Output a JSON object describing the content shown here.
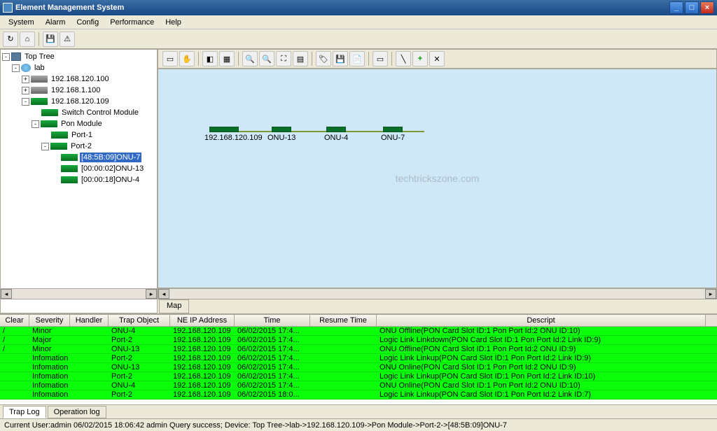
{
  "window": {
    "title": "Element Management System"
  },
  "menu": [
    "System",
    "Alarm",
    "Config",
    "Performance",
    "Help"
  ],
  "tree": {
    "root": "Top Tree",
    "lab": "lab",
    "nodes": [
      "192.168.120.100",
      "192.168.1.100",
      "192.168.120.109"
    ],
    "switch_module": "Switch Control Module",
    "pon_module": "Pon Module",
    "port1": "Port-1",
    "port2": "Port-2",
    "onu7": "[48:5B:09]ONU-7",
    "onu13": "[00:00:02]ONU-13",
    "onu4": "[00:00:18]ONU-4"
  },
  "canvas": {
    "host": "192.168.120.109",
    "devs": [
      "ONU-13",
      "ONU-4",
      "ONU-7"
    ],
    "watermark": "techtrickszone.com",
    "tab": "Map"
  },
  "log": {
    "headers": [
      "Clear",
      "Severity",
      "Handler",
      "Trap Object",
      "NE IP Address",
      "Time",
      "Resume Time",
      "Descript"
    ],
    "rows": [
      {
        "c": "/",
        "sev": "Minor",
        "obj": "ONU-4",
        "ip": "192.168.120.109",
        "t": "06/02/2015 17:4...",
        "d": "ONU Offline(PON Card Slot ID:1  Pon Port Id:2  ONU ID:10)"
      },
      {
        "c": "/",
        "sev": "Major",
        "obj": "Port-2",
        "ip": "192.168.120.109",
        "t": "06/02/2015 17:4...",
        "d": "Logic Link Linkdown(PON Card Slot ID:1  Pon Port Id:2  Link ID:9)"
      },
      {
        "c": "/",
        "sev": "Minor",
        "obj": "ONU-13",
        "ip": "192.168.120.109",
        "t": "06/02/2015 17:4...",
        "d": "ONU Offline(PON Card Slot ID:1  Pon Port Id:2  ONU ID:9)"
      },
      {
        "c": "",
        "sev": "Infomation",
        "obj": "Port-2",
        "ip": "192.168.120.109",
        "t": "06/02/2015 17:4...",
        "d": "Logic Link Linkup(PON Card Slot ID:1  Pon Port Id:2  Link ID:9)"
      },
      {
        "c": "",
        "sev": "Infomation",
        "obj": "ONU-13",
        "ip": "192.168.120.109",
        "t": "06/02/2015 17:4...",
        "d": "ONU Online(PON Card Slot ID:1  Pon Port Id:2  ONU ID:9)"
      },
      {
        "c": "",
        "sev": "Infomation",
        "obj": "Port-2",
        "ip": "192.168.120.109",
        "t": "06/02/2015 17:4...",
        "d": "Logic Link Linkup(PON Card Slot ID:1  Pon Port Id:2  Link ID:10)"
      },
      {
        "c": "",
        "sev": "Infomation",
        "obj": "ONU-4",
        "ip": "192.168.120.109",
        "t": "06/02/2015 17:4...",
        "d": "ONU Online(PON Card Slot ID:1  Pon Port Id:2  ONU ID:10)"
      },
      {
        "c": "",
        "sev": "Infomation",
        "obj": "Port-2",
        "ip": "192.168.120.109",
        "t": "06/02/2015 18:0...",
        "d": "Logic Link Linkup(PON Card Slot ID:1  Pon Port Id:2  Link ID:7)"
      }
    ]
  },
  "tabs": {
    "trap": "Trap Log",
    "op": "Operation log"
  },
  "status": "Current User:admin   06/02/2015 18:06:42  admin  Query  success; Device: Top Tree->lab->192.168.120.109->Pon Module->Port-2->[48:5B:09]ONU-7",
  "col_widths": {
    "clear": 42,
    "sev": 58,
    "handler": 55,
    "obj": 88,
    "ip": 92,
    "time": 108,
    "resume": 95
  }
}
